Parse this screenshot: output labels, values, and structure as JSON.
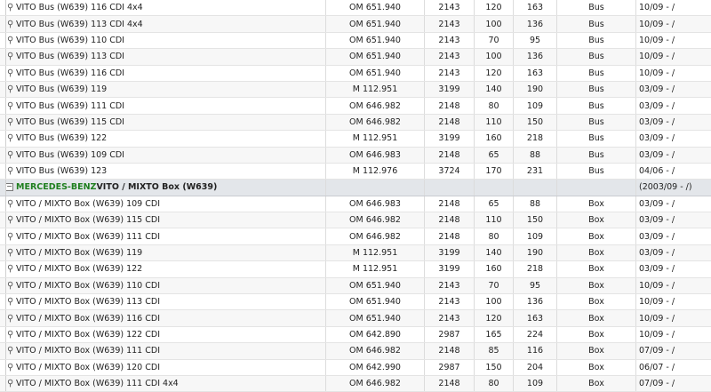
{
  "rows": [
    {
      "name": "VITO Bus (W639) 116 CDI 4x4",
      "engine": "OM 651.940",
      "ccm": "2143",
      "kw": "120",
      "hp": "163",
      "body": "Bus",
      "period": "10/09 - /"
    },
    {
      "name": "VITO Bus (W639) 113 CDI 4x4",
      "engine": "OM 651.940",
      "ccm": "2143",
      "kw": "100",
      "hp": "136",
      "body": "Bus",
      "period": "10/09 - /"
    },
    {
      "name": "VITO Bus (W639) 110 CDI",
      "engine": "OM 651.940",
      "ccm": "2143",
      "kw": "70",
      "hp": "95",
      "body": "Bus",
      "period": "10/09 - /"
    },
    {
      "name": "VITO Bus (W639) 113 CDI",
      "engine": "OM 651.940",
      "ccm": "2143",
      "kw": "100",
      "hp": "136",
      "body": "Bus",
      "period": "10/09 - /"
    },
    {
      "name": "VITO Bus (W639) 116 CDI",
      "engine": "OM 651.940",
      "ccm": "2143",
      "kw": "120",
      "hp": "163",
      "body": "Bus",
      "period": "10/09 - /"
    },
    {
      "name": "VITO Bus (W639) 119",
      "engine": "M 112.951",
      "ccm": "3199",
      "kw": "140",
      "hp": "190",
      "body": "Bus",
      "period": "03/09 - /"
    },
    {
      "name": "VITO Bus (W639) 111 CDI",
      "engine": "OM 646.982",
      "ccm": "2148",
      "kw": "80",
      "hp": "109",
      "body": "Bus",
      "period": "03/09 - /"
    },
    {
      "name": "VITO Bus (W639) 115 CDI",
      "engine": "OM 646.982",
      "ccm": "2148",
      "kw": "110",
      "hp": "150",
      "body": "Bus",
      "period": "03/09 - /"
    },
    {
      "name": "VITO Bus (W639) 122",
      "engine": "M 112.951",
      "ccm": "3199",
      "kw": "160",
      "hp": "218",
      "body": "Bus",
      "period": "03/09 - /"
    },
    {
      "name": "VITO Bus (W639) 109 CDI",
      "engine": "OM 646.983",
      "ccm": "2148",
      "kw": "65",
      "hp": "88",
      "body": "Bus",
      "period": "03/09 - /"
    },
    {
      "name": "VITO Bus (W639) 123",
      "engine": "M 112.976",
      "ccm": "3724",
      "kw": "170",
      "hp": "231",
      "body": "Bus",
      "period": "04/06 - /"
    }
  ],
  "group": {
    "make": "MERCEDES-BENZ",
    "model": "VITO / MIXTO Box (W639)",
    "period": "(2003/09 - /)"
  },
  "rows2": [
    {
      "name": "VITO / MIXTO Box (W639) 109 CDI",
      "engine": "OM 646.983",
      "ccm": "2148",
      "kw": "65",
      "hp": "88",
      "body": "Box",
      "period": "03/09 - /"
    },
    {
      "name": "VITO / MIXTO Box (W639) 115 CDI",
      "engine": "OM 646.982",
      "ccm": "2148",
      "kw": "110",
      "hp": "150",
      "body": "Box",
      "period": "03/09 - /"
    },
    {
      "name": "VITO / MIXTO Box (W639) 111 CDI",
      "engine": "OM 646.982",
      "ccm": "2148",
      "kw": "80",
      "hp": "109",
      "body": "Box",
      "period": "03/09 - /"
    },
    {
      "name": "VITO / MIXTO Box (W639) 119",
      "engine": "M 112.951",
      "ccm": "3199",
      "kw": "140",
      "hp": "190",
      "body": "Box",
      "period": "03/09 - /"
    },
    {
      "name": "VITO / MIXTO Box (W639) 122",
      "engine": "M 112.951",
      "ccm": "3199",
      "kw": "160",
      "hp": "218",
      "body": "Box",
      "period": "03/09 - /"
    },
    {
      "name": "VITO / MIXTO Box (W639) 110 CDI",
      "engine": "OM 651.940",
      "ccm": "2143",
      "kw": "70",
      "hp": "95",
      "body": "Box",
      "period": "10/09 - /"
    },
    {
      "name": "VITO / MIXTO Box (W639) 113 CDI",
      "engine": "OM 651.940",
      "ccm": "2143",
      "kw": "100",
      "hp": "136",
      "body": "Box",
      "period": "10/09 - /"
    },
    {
      "name": "VITO / MIXTO Box (W639) 116 CDI",
      "engine": "OM 651.940",
      "ccm": "2143",
      "kw": "120",
      "hp": "163",
      "body": "Box",
      "period": "10/09 - /"
    },
    {
      "name": "VITO / MIXTO Box (W639) 122 CDI",
      "engine": "OM 642.890",
      "ccm": "2987",
      "kw": "165",
      "hp": "224",
      "body": "Box",
      "period": "10/09 - /"
    },
    {
      "name": "VITO / MIXTO Box (W639) 111 CDI",
      "engine": "OM 646.982",
      "ccm": "2148",
      "kw": "85",
      "hp": "116",
      "body": "Box",
      "period": "07/09 - /"
    },
    {
      "name": "VITO / MIXTO Box (W639) 120 CDI",
      "engine": "OM 642.990",
      "ccm": "2987",
      "kw": "150",
      "hp": "204",
      "body": "Box",
      "period": "06/07 - /"
    },
    {
      "name": "VITO / MIXTO Box (W639) 111 CDI 4x4",
      "engine": "OM 646.982",
      "ccm": "2148",
      "kw": "80",
      "hp": "109",
      "body": "Box",
      "period": "07/09 - /"
    }
  ]
}
